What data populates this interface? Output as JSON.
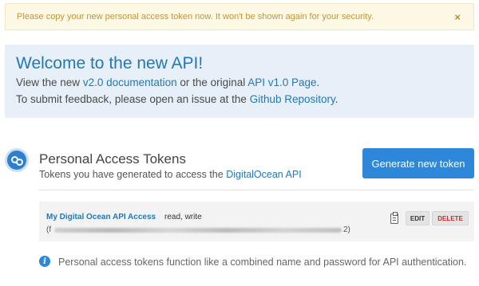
{
  "alert": {
    "message": "Please copy your new personal access token now. It won't be shown again for your security.",
    "close_glyph": "×"
  },
  "welcome": {
    "title": "Welcome to the new API!",
    "line1_prefix": "View the new ",
    "line1_link1": "v2.0 documentation",
    "line1_middle": " or the original ",
    "line1_link2": "API v1.0 Page",
    "line1_suffix": ".",
    "line2_prefix": "To submit feedback, please open an issue at the ",
    "line2_link": "Github Repository",
    "line2_suffix": "."
  },
  "tokens_section": {
    "icon": "tokens-icon",
    "title": "Personal Access Tokens",
    "subtitle_prefix": "Tokens you have generated to access the ",
    "subtitle_link": "DigitalOcean API",
    "generate_button": "Generate new token"
  },
  "token": {
    "name": "My Digital Ocean API Access",
    "scopes": "read, write",
    "value_open": "(f",
    "value_close": "2)",
    "copy_icon": "clipboard-icon",
    "edit_label": "EDIT",
    "delete_label": "DELETE"
  },
  "info": {
    "icon": "info-icon",
    "glyph": "i",
    "text": "Personal access tokens function like a combined name and password for API authentication."
  },
  "colors": {
    "accent_blue": "#2e87d8",
    "link_blue": "#2178b8",
    "alert_bg": "#fcf8e3",
    "alert_text": "#c0963c",
    "welcome_bg": "#e7f0f8",
    "delete_red": "#cc2b2b"
  }
}
